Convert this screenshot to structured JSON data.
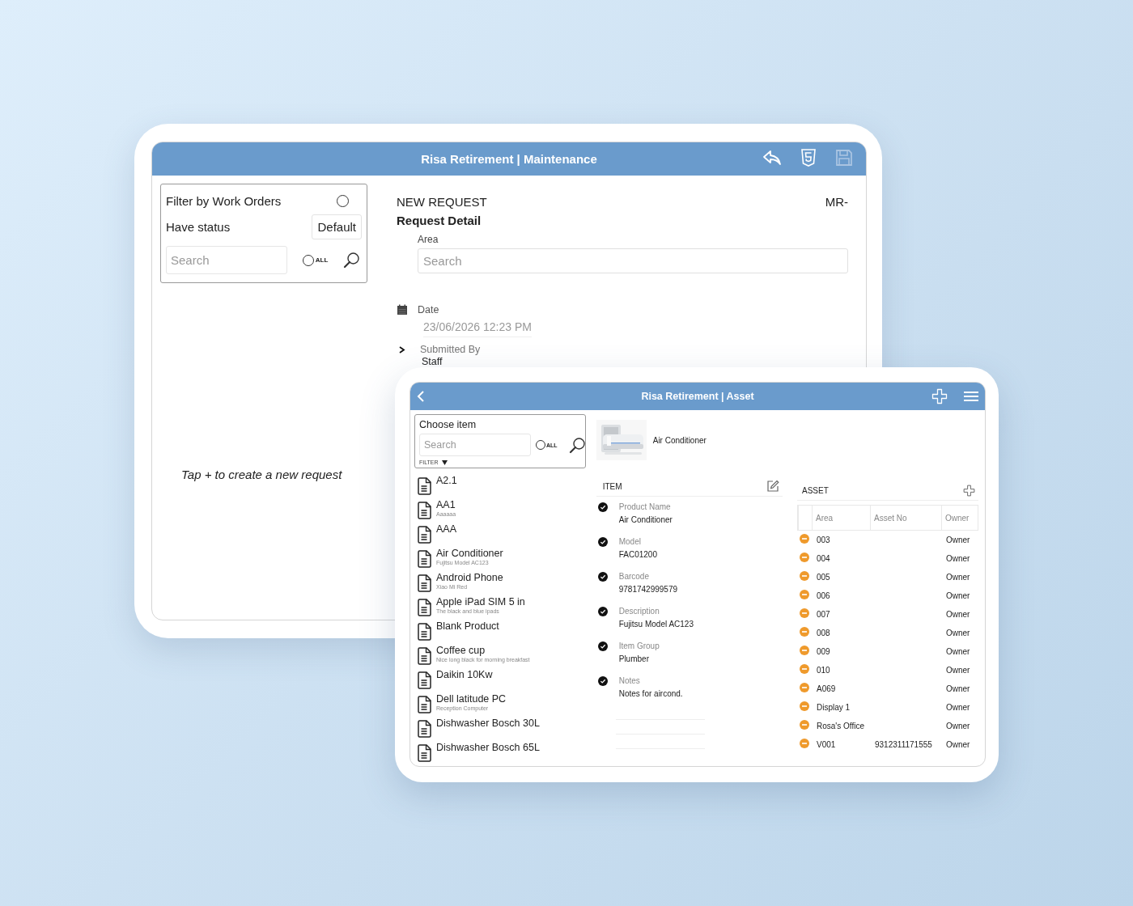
{
  "maintenance": {
    "title": "Risa Retirement | Maintenance",
    "filter": {
      "label": "Filter by Work Orders",
      "checked": false,
      "status_label": "Have status",
      "status_value": "Default",
      "search_placeholder": "Search",
      "all_label": "ALL",
      "all_checked": false
    },
    "empty_hint": "Tap + to create a new request",
    "request": {
      "heading": "NEW REQUEST",
      "number": "MR-",
      "section": "Request Detail",
      "area_label": "Area",
      "area_placeholder": "Search",
      "date_label": "Date",
      "date_value": "23/06/2026 12:23 PM",
      "submitted_label": "Submitted By",
      "submitted_value": "Staff"
    }
  },
  "asset_screen": {
    "title": "Risa Retirement | Asset",
    "chooser": {
      "label": "Choose item",
      "search_placeholder": "Search",
      "all_label": "ALL",
      "all_checked": false,
      "filter_label": "FILTER"
    },
    "items": [
      {
        "name": "A2.1"
      },
      {
        "name": "AA1",
        "detail": "Aaaaaa"
      },
      {
        "name": "AAA"
      },
      {
        "name": "Air Conditioner",
        "detail": "Fujitsu Model AC123"
      },
      {
        "name": "Android Phone",
        "detail": "Xiao Mi Red"
      },
      {
        "name": "Apple iPad SIM 5 in",
        "detail": "The black and blue ipads"
      },
      {
        "name": "Blank Product"
      },
      {
        "name": "Coffee cup",
        "detail": "Nice long black for morning breakfast"
      },
      {
        "name": "Daikin 10Kw"
      },
      {
        "name": "Dell latitude PC",
        "detail": "Reception Computer"
      },
      {
        "name": "Dishwasher Bosch 30L"
      },
      {
        "name": "Dishwasher Bosch 65L"
      }
    ],
    "product": {
      "kind": "picture",
      "name": "Air Conditioner"
    },
    "item_section": {
      "heading": "ITEM",
      "fields": [
        {
          "label": "Product Name",
          "value": "Air Conditioner"
        },
        {
          "label": "Model",
          "value": "FAC01200"
        },
        {
          "label": "Barcode",
          "value": "9781742999579"
        },
        {
          "label": "Description",
          "value": "Fujitsu Model AC123"
        },
        {
          "label": "Item Group",
          "value": "Plumber"
        },
        {
          "label": "Notes",
          "value": "Notes for aircond."
        }
      ]
    },
    "asset_section": {
      "heading": "ASSET",
      "columns": [
        "Area",
        "Asset No",
        "Owner"
      ],
      "rows": [
        {
          "area": "003",
          "owner": "Owner"
        },
        {
          "area": "004",
          "owner": "Owner"
        },
        {
          "area": "005",
          "owner": "Owner"
        },
        {
          "area": "006",
          "owner": "Owner"
        },
        {
          "area": "007",
          "owner": "Owner"
        },
        {
          "area": "008",
          "owner": "Owner"
        },
        {
          "area": "009",
          "owner": "Owner"
        },
        {
          "area": "010",
          "owner": "Owner"
        },
        {
          "area": "A069",
          "owner": "Owner"
        },
        {
          "area": "Display 1",
          "owner": "Owner"
        },
        {
          "area": "Rosa's Office",
          "owner": "Owner"
        },
        {
          "area": "V001",
          "asset_no": "9312311171555",
          "owner": "Owner"
        }
      ]
    }
  }
}
